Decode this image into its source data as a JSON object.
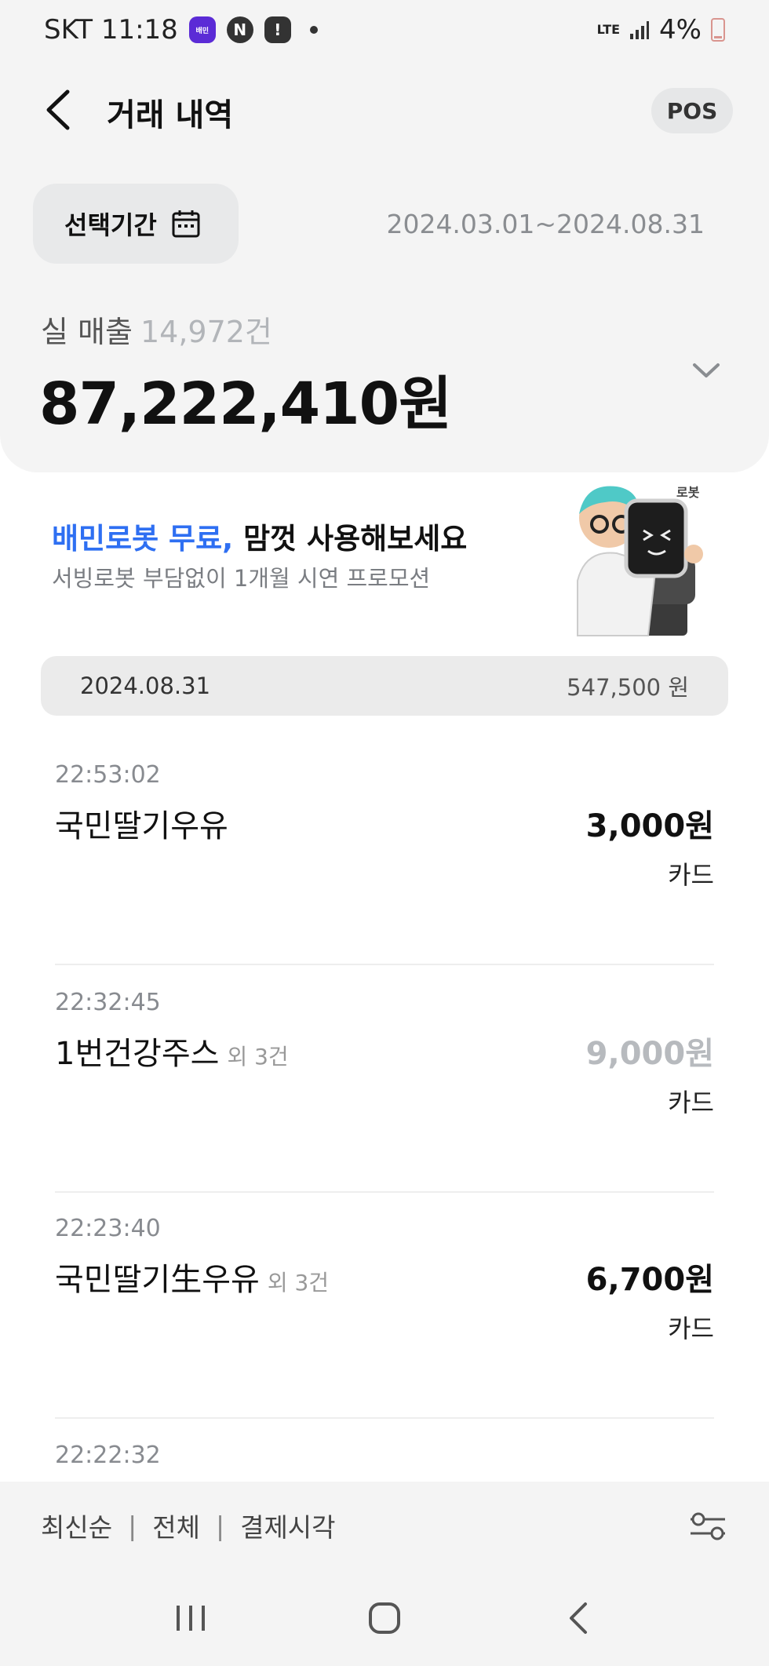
{
  "status_bar": {
    "carrier_time": "SKT 11:18",
    "app_icon_1": "배민",
    "app_icon_2": "N",
    "app_icon_3": "!",
    "network": "LTE",
    "battery": "4%"
  },
  "header": {
    "title": "거래 내역",
    "pos_label": "POS",
    "back_icon": "chevron-left-icon"
  },
  "period": {
    "button_label": "선택기간",
    "icon": "calendar-icon",
    "range": "2024.03.01~2024.08.31"
  },
  "sales": {
    "label": "실 매출",
    "count": "14,972건",
    "total": "87,222,410원"
  },
  "banner": {
    "title_highlight": "배민로봇 무료,",
    "title_rest": " 맘껏 사용해보세요",
    "subtitle": "서빙로봇 부담없이 1개월 시연 프로모션",
    "brand": "로봇"
  },
  "day_group": {
    "date": "2024.08.31",
    "amount": "547,500 원"
  },
  "transactions": [
    {
      "time": "22:53:02",
      "name": "국민딸기우유",
      "extra": "",
      "amount": "3,000원",
      "method": "카드",
      "muted": false
    },
    {
      "time": "22:32:45",
      "name": "1번건강주스",
      "extra": "외 3건",
      "amount": "9,000원",
      "method": "카드",
      "muted": true
    },
    {
      "time": "22:23:40",
      "name": "국민딸기生우유",
      "extra": "외 3건",
      "amount": "6,700원",
      "method": "카드",
      "muted": false
    },
    {
      "time": "22:22:32",
      "name": "",
      "extra": "",
      "amount": "",
      "method": "",
      "muted": false
    }
  ],
  "filter_bar": {
    "sort": "최신순",
    "scope": "전체",
    "payment": "결제시각",
    "separator": "|"
  },
  "colors": {
    "accent_blue": "#2e6ff2",
    "panel_bg": "#f4f4f4",
    "muted_text": "#b7babe"
  }
}
